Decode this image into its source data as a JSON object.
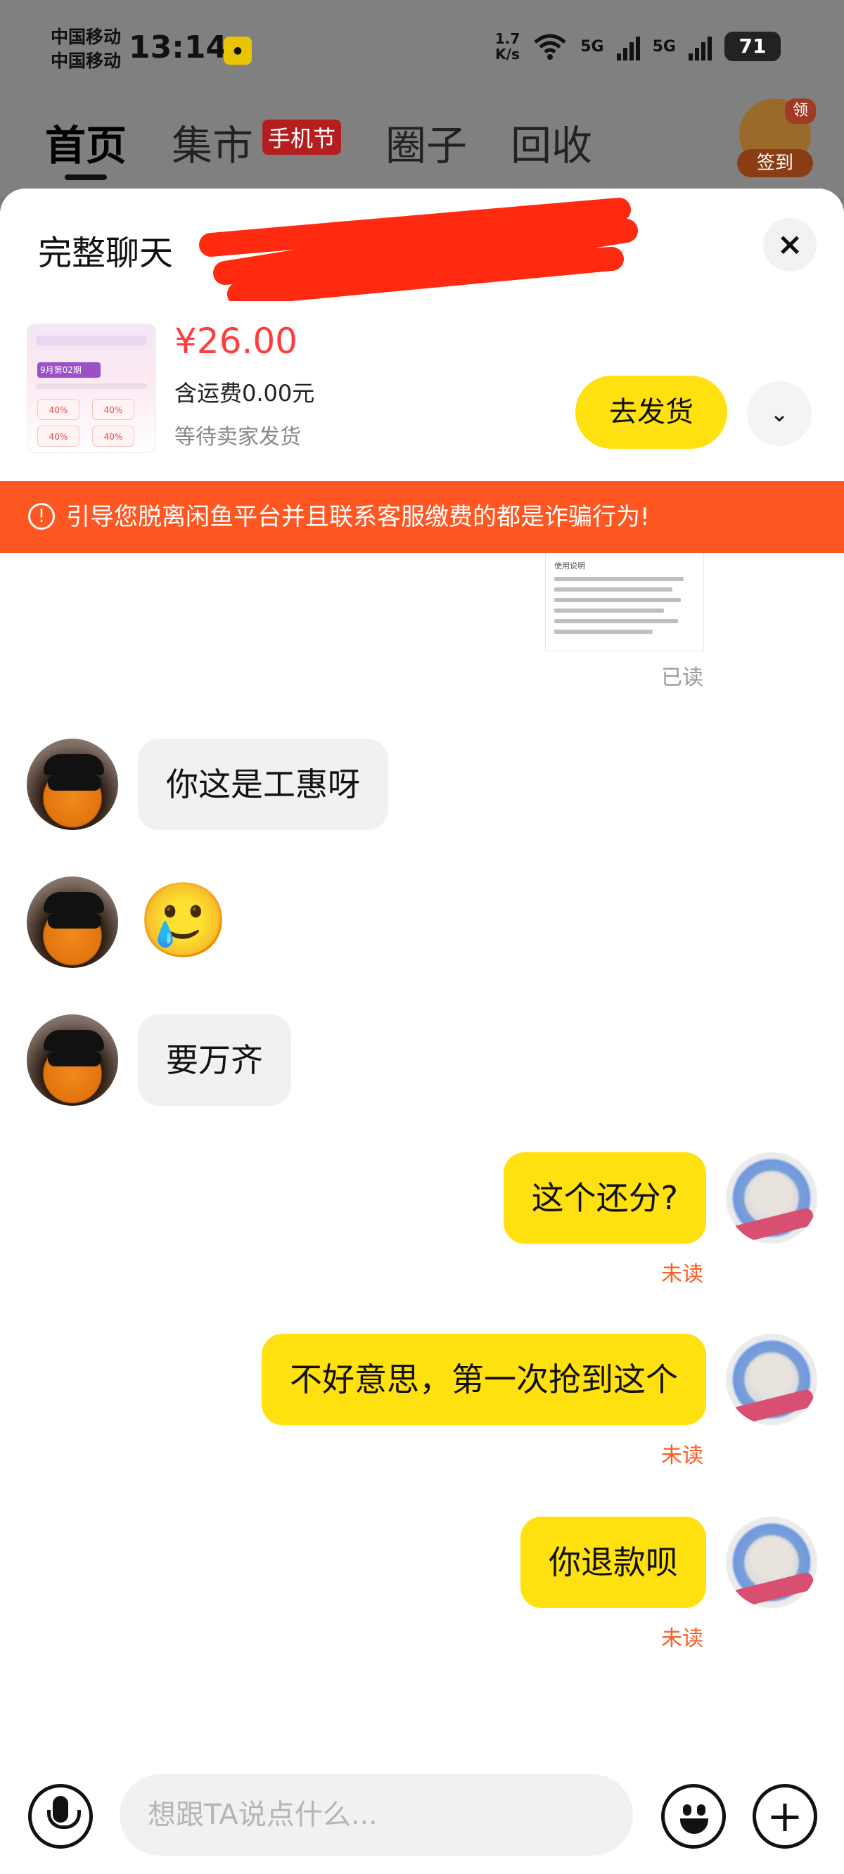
{
  "status_bar": {
    "carrier_1": "中国移动",
    "carrier_2": "中国移动",
    "time": "13:14",
    "net_speed_value": "1.7",
    "net_speed_unit": "K/s",
    "network_1": "5G",
    "network_2": "5G",
    "battery": "71"
  },
  "background_nav": {
    "tabs": [
      "首页",
      "集市",
      "圈子",
      "回收"
    ],
    "festival_badge": "手机节",
    "signin_label": "签到",
    "signin_badge": "领"
  },
  "sheet": {
    "title": "完整聊天",
    "close_glyph": "×"
  },
  "order": {
    "price": "¥26.00",
    "shipping": "含运费0.00元",
    "status": "等待卖家发货",
    "ship_button": "去发货",
    "expand_glyph": "⌄",
    "thumbnail_text": "9月第02期"
  },
  "warning": {
    "icon": "!",
    "text": "引导您脱离闲鱼平台并且联系客服缴费的都是诈骗行为!"
  },
  "doc_preview": {
    "heading": "使用说明"
  },
  "read_label": "已读",
  "messages": {
    "m1": "你这是工惠呀",
    "m2_emoji": "🥲",
    "m3": "要万齐",
    "m4": "这个还分?",
    "m5": "不好意思，第一次抢到这个",
    "m6": "你退款呗",
    "unread_label": "未读"
  },
  "input": {
    "placeholder": "想跟TA说点什么..."
  },
  "colors": {
    "accent_yellow": "#ffe10f",
    "warning_orange": "#ff5722",
    "price_red": "#ff3d3d",
    "unread_orange": "#ff5a1f"
  }
}
